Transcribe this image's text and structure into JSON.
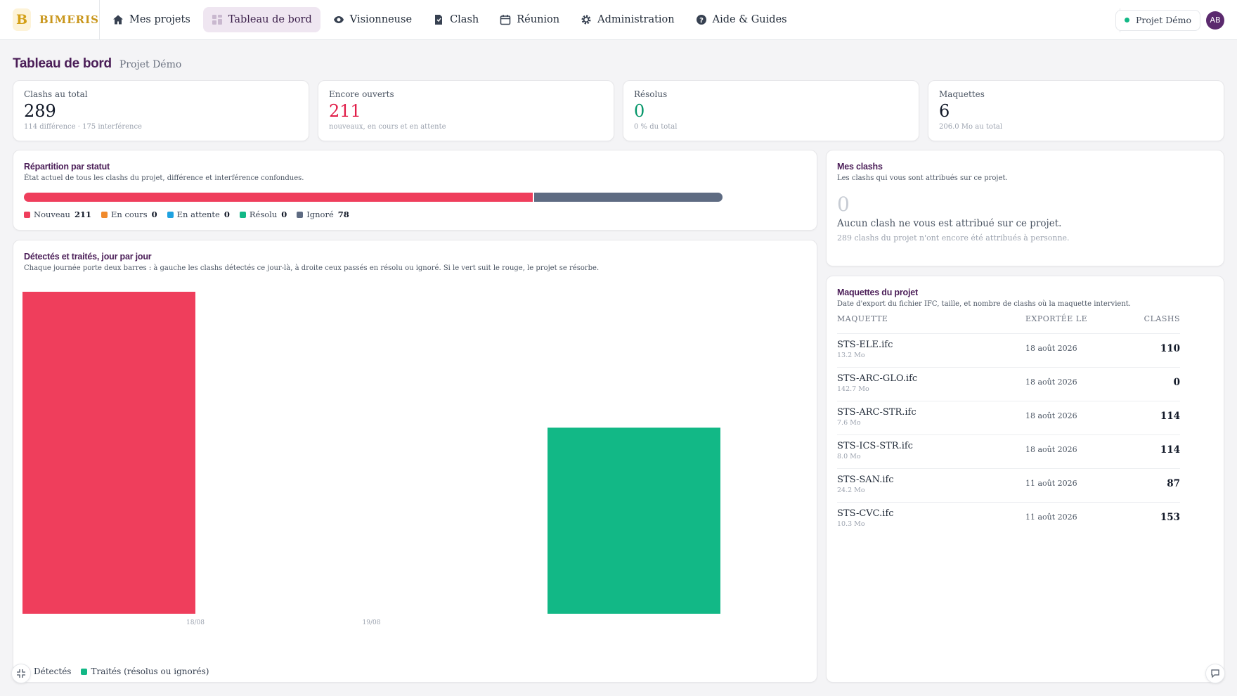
{
  "brand": {
    "logo_letter": "B",
    "name": "BIMERIS"
  },
  "nav": [
    {
      "label": "Mes projets",
      "icon": "home-icon",
      "active": false
    },
    {
      "label": "Tableau de bord",
      "icon": "dashboard-icon",
      "active": true
    },
    {
      "label": "Visionneuse",
      "icon": "eye-icon",
      "active": false
    },
    {
      "label": "Clash",
      "icon": "file-icon",
      "active": false
    },
    {
      "label": "Réunion",
      "icon": "calendar-icon",
      "active": false
    },
    {
      "label": "Administration",
      "icon": "gear-icon",
      "active": false
    },
    {
      "label": "Aide & Guides",
      "icon": "help-icon",
      "active": false
    }
  ],
  "topbar": {
    "project": "Projet Démo",
    "avatar": "AB"
  },
  "page": {
    "title": "Tableau de bord",
    "subtitle": "Projet Démo"
  },
  "stats": [
    {
      "label": "Clashs au total",
      "value": "289",
      "note": "114 différence · 175 interférence",
      "color": "#111827"
    },
    {
      "label": "Encore ouverts",
      "value": "211",
      "note": "nouveaux, en cours et en attente",
      "color": "#e11d48"
    },
    {
      "label": "Résolus",
      "value": "0",
      "note": "0 % du total",
      "color": "#059669"
    },
    {
      "label": "Maquettes",
      "value": "6",
      "note": "206.0 Mo au total",
      "color": "#111827"
    }
  ],
  "status": {
    "title": "Répartition par statut",
    "desc": "État actuel de tous les clashs du projet, différence et interférence confondues.",
    "items": [
      {
        "label": "Nouveau",
        "count": 211,
        "color": "#ef3e5c"
      },
      {
        "label": "En cours",
        "count": 0,
        "color": "#f08a2c"
      },
      {
        "label": "En attente",
        "count": 0,
        "color": "#1fa2e0"
      },
      {
        "label": "Résolu",
        "count": 0,
        "color": "#12b886"
      },
      {
        "label": "Ignoré",
        "count": 78,
        "color": "#5e6b82"
      }
    ]
  },
  "mine": {
    "title": "Mes clashs",
    "desc": "Les clashs qui vous sont attribués sur ce projet.",
    "count": "0",
    "empty": "Aucun clash ne vous est attribué sur ce projet.",
    "sub": "289 clashs du projet n'ont encore été attribués à personne."
  },
  "daily": {
    "title": "Détectés et traités, jour par jour",
    "desc": "Chaque journée porte deux barres : à gauche les clashs détectés ce jour-là, à droite ceux passés en résolu ou ignoré. Si le vert suit le rouge, le projet se résorbe."
  },
  "chart_data": {
    "type": "bar",
    "categories": [
      "18/08",
      "19/08"
    ],
    "series": [
      {
        "name": "Détectés",
        "values": [
          289,
          0
        ],
        "color": "#ef3e5c"
      },
      {
        "name": "Traités (résolus ou ignorés)",
        "values": [
          0,
          167
        ],
        "color": "#12b886"
      }
    ],
    "ylim": [
      0,
      289
    ]
  },
  "models": {
    "title": "Maquettes du projet",
    "desc": "Date d'export du fichier IFC, taille, et nombre de clashs où la maquette intervient.",
    "headers": {
      "name": "MAQUETTE",
      "date": "EXPORTÉE LE",
      "clashes": "CLASHS"
    },
    "rows": [
      {
        "name": "STS-ELE.ifc",
        "size": "13.2 Mo",
        "date": "18 août 2026",
        "clashes": "110"
      },
      {
        "name": "STS-ARC-GLO.ifc",
        "size": "142.7 Mo",
        "date": "18 août 2026",
        "clashes": "0"
      },
      {
        "name": "STS-ARC-STR.ifc",
        "size": "7.6 Mo",
        "date": "18 août 2026",
        "clashes": "114"
      },
      {
        "name": "STS-ICS-STR.ifc",
        "size": "8.0 Mo",
        "date": "18 août 2026",
        "clashes": "114"
      },
      {
        "name": "STS-SAN.ifc",
        "size": "24.2 Mo",
        "date": "11 août 2026",
        "clashes": "87"
      },
      {
        "name": "STS-CVC.ifc",
        "size": "10.3 Mo",
        "date": "11 août 2026",
        "clashes": "153"
      }
    ]
  }
}
